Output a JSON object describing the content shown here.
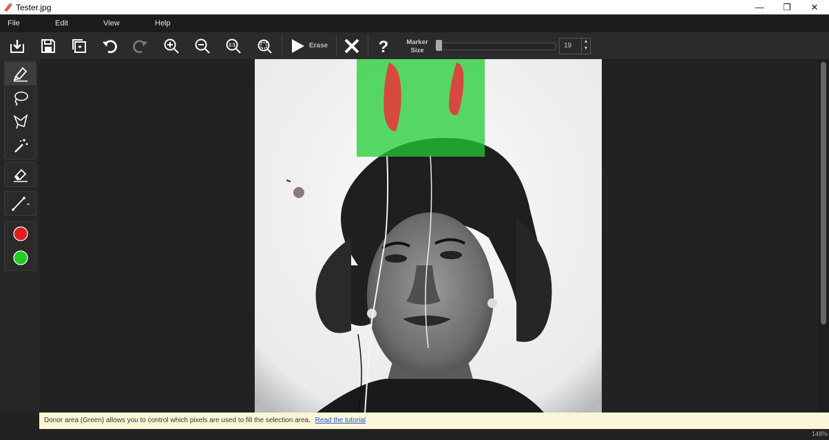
{
  "window": {
    "title": "Tester.jpg",
    "minimize": "—",
    "restore": "❐",
    "close": "✕"
  },
  "menu": {
    "file": "File",
    "edit": "Edit",
    "view": "View",
    "help": "Help"
  },
  "toolbar": {
    "erase_label": "Erase",
    "marker_label_line1": "Marker",
    "marker_label_line2": "Size",
    "marker_size": "19",
    "marker_size_level": 0.05
  },
  "colors": {
    "selection_red": "#e53a3a",
    "donor_green": "#22cc33",
    "accent": "#2b2b2b"
  },
  "status": {
    "message": "Donor area (Green) allows you to control which pixels are used to fill the selection area.",
    "link": "Read the tutorial"
  },
  "zoom": "148%"
}
